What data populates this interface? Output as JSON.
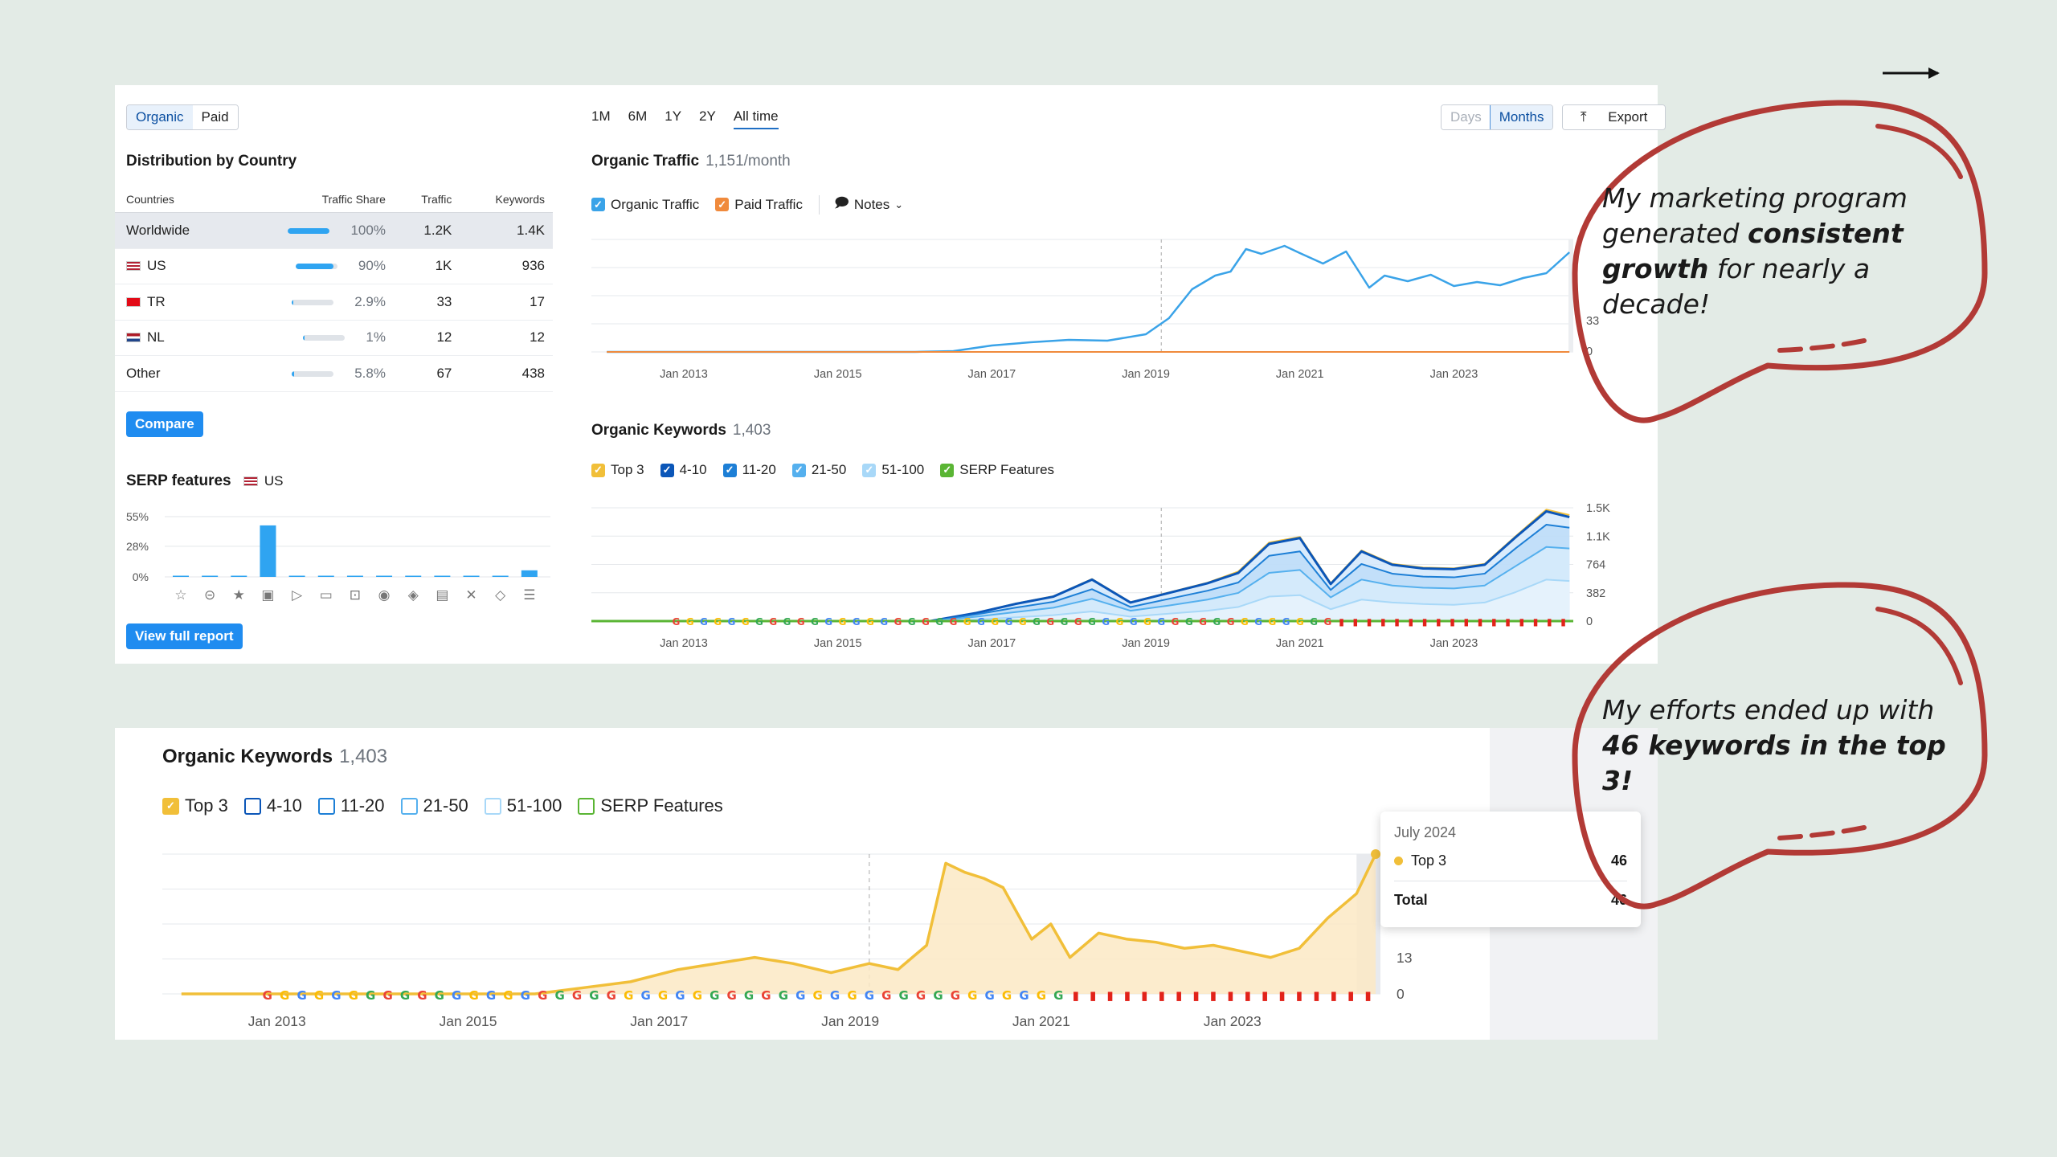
{
  "top_panel": {
    "toggle": {
      "organic": "Organic",
      "paid": "Paid"
    },
    "distribution": {
      "title": "Distribution by Country",
      "headers": [
        "Countries",
        "Traffic Share",
        "Traffic",
        "Keywords"
      ],
      "rows": [
        {
          "country": "Worldwide",
          "share": "100%",
          "share_fraction": 1.0,
          "traffic": "1.2K",
          "keywords": "1.4K"
        },
        {
          "country": "US",
          "share": "90%",
          "share_fraction": 0.9,
          "traffic": "1K",
          "keywords": "936"
        },
        {
          "country": "TR",
          "share": "2.9%",
          "share_fraction": 0.029,
          "traffic": "33",
          "keywords": "17"
        },
        {
          "country": "NL",
          "share": "1%",
          "share_fraction": 0.01,
          "traffic": "12",
          "keywords": "12"
        },
        {
          "country": "Other",
          "share": "5.8%",
          "share_fraction": 0.058,
          "traffic": "67",
          "keywords": "438"
        }
      ]
    },
    "compare_label": "Compare",
    "serp": {
      "title": "SERP features",
      "country": "US",
      "view_full_report": "View full report"
    },
    "time_tabs": [
      "1M",
      "6M",
      "1Y",
      "2Y",
      "All time"
    ],
    "active_tab": "All time",
    "granularity": {
      "days": "Days",
      "months": "Months"
    },
    "export_label": "Export",
    "traffic": {
      "title": "Organic Traffic",
      "value": "1,151/month",
      "legend": [
        "Organic Traffic",
        "Paid Traffic"
      ],
      "notes_label": "Notes"
    },
    "keywords": {
      "title": "Organic Keywords",
      "value": "1,403",
      "legend": [
        "Top 3",
        "4-10",
        "11-20",
        "21-50",
        "51-100",
        "SERP Features"
      ]
    }
  },
  "bottom_panel": {
    "title": "Organic Keywords",
    "value": "1,403",
    "legend": [
      "Top 3",
      "4-10",
      "11-20",
      "21-50",
      "51-100",
      "SERP Features"
    ],
    "tooltip": {
      "date": "July 2024",
      "series": "Top 3",
      "series_value": "46",
      "total_label": "Total",
      "total_value": "46"
    }
  },
  "callouts": {
    "first": {
      "pre": "My marketing program generated ",
      "bold": "consistent growth",
      "post": " for nearly a decade!"
    },
    "second": {
      "pre": "My efforts ended up with ",
      "bold": "46 keywords in the top 3!",
      "post": ""
    }
  },
  "colors": {
    "organic": "#3aa3e8",
    "paid": "#f08a3c",
    "top3": "#f1bf39",
    "k4_10": "#0b56b8",
    "k11_20": "#1d7fd6",
    "k21_50": "#55b0ee",
    "k51_100": "#a8d8f8",
    "serp": "#5ab534",
    "callout": "#b23a36"
  },
  "chart_data": [
    {
      "type": "bar",
      "title": "SERP features",
      "ylabel": "",
      "yticks": [
        "55%",
        "28%",
        "0%"
      ],
      "ylim": [
        0,
        55
      ],
      "categories": [
        "featured snippet",
        "sitelinks",
        "reviews",
        "image",
        "video",
        "featured video",
        "people also ask",
        "local pack",
        "knowledge panel",
        "news",
        "X",
        "shopping",
        "more"
      ],
      "values": [
        0,
        0.5,
        0,
        47,
        0,
        0,
        0.5,
        0,
        0.5,
        0,
        0,
        0.5,
        6
      ]
    },
    {
      "type": "line",
      "title": "Organic Traffic",
      "x_ticks": [
        "Jan 2013",
        "Jan 2015",
        "Jan 2017",
        "Jan 2019",
        "Jan 2021",
        "Jan 2023"
      ],
      "y_ticks": [
        "33",
        "0"
      ],
      "series": [
        {
          "name": "Organic Traffic",
          "x": [
            2012.0,
            2013.0,
            2014.0,
            2015.0,
            2016.0,
            2016.5,
            2017.0,
            2017.5,
            2018.0,
            2018.5,
            2019.0,
            2019.3,
            2019.6,
            2019.9,
            2020.1,
            2020.3,
            2020.5,
            2020.8,
            2021.0,
            2021.3,
            2021.6,
            2021.9,
            2022.1,
            2022.4,
            2022.7,
            2023.0,
            2023.3,
            2023.6,
            2023.9,
            2024.2,
            2024.5
          ],
          "y": [
            0,
            0,
            0,
            0,
            0,
            10,
            80,
            120,
            150,
            140,
            220,
            420,
            780,
            950,
            1000,
            1280,
            1220,
            1320,
            1230,
            1100,
            1250,
            800,
            950,
            880,
            960,
            820,
            870,
            830,
            920,
            980,
            1240
          ]
        },
        {
          "name": "Paid Traffic",
          "x": [
            2012.0,
            2024.5
          ],
          "y": [
            0,
            0
          ]
        }
      ]
    },
    {
      "type": "area",
      "title": "Organic Keywords",
      "x_ticks": [
        "Jan 2013",
        "Jan 2015",
        "Jan 2017",
        "Jan 2019",
        "Jan 2021",
        "Jan 2023"
      ],
      "y_ticks": [
        "1.5K",
        "1.1K",
        "764",
        "382",
        "0"
      ],
      "ylim": [
        0,
        1528
      ],
      "x": [
        2012.0,
        2016.2,
        2016.8,
        2017.3,
        2017.8,
        2018.3,
        2018.8,
        2019.3,
        2019.8,
        2020.2,
        2020.6,
        2021.0,
        2021.4,
        2021.8,
        2022.2,
        2022.6,
        2023.0,
        2023.4,
        2023.8,
        2024.2,
        2024.5
      ],
      "series": [
        {
          "name": "Top 3",
          "values": [
            0,
            0,
            4,
            8,
            10,
            12,
            9,
            11,
            14,
            30,
            32,
            26,
            18,
            22,
            20,
            20,
            18,
            20,
            22,
            40,
            46
          ]
        },
        {
          "name": "4-10",
          "values": [
            0,
            0,
            110,
            230,
            330,
            560,
            250,
            380,
            510,
            650,
            1040,
            1120,
            500,
            940,
            760,
            710,
            700,
            760,
            1130,
            1480,
            1403
          ]
        },
        {
          "name": "11-20",
          "values": [
            0,
            0,
            90,
            180,
            260,
            430,
            190,
            300,
            410,
            520,
            880,
            940,
            420,
            770,
            640,
            600,
            590,
            640,
            980,
            1300,
            1260
          ]
        },
        {
          "name": "21-50",
          "values": [
            0,
            0,
            60,
            120,
            180,
            300,
            140,
            210,
            290,
            380,
            650,
            690,
            320,
            560,
            480,
            450,
            440,
            480,
            740,
            1000,
            980
          ]
        },
        {
          "name": "51-100",
          "values": [
            0,
            0,
            20,
            50,
            80,
            130,
            60,
            100,
            140,
            190,
            330,
            350,
            160,
            290,
            250,
            230,
            220,
            250,
            390,
            560,
            540
          ]
        }
      ]
    },
    {
      "type": "area",
      "title": "Organic Keywords",
      "x_ticks": [
        "Jan 2013",
        "Jan 2015",
        "Jan 2017",
        "Jan 2019",
        "Jan 2021",
        "Jan 2023"
      ],
      "y_ticks": [
        "13",
        "0"
      ],
      "ylim": [
        0,
        46
      ],
      "series": [
        {
          "name": "Top 3",
          "x": [
            2012.0,
            2015.7,
            2016.2,
            2016.7,
            2017.2,
            2017.6,
            2018.0,
            2018.4,
            2018.8,
            2019.2,
            2019.5,
            2019.8,
            2020.0,
            2020.2,
            2020.4,
            2020.6,
            2020.9,
            2021.1,
            2021.3,
            2021.6,
            2021.9,
            2022.2,
            2022.5,
            2022.8,
            2023.1,
            2023.4,
            2023.7,
            2024.0,
            2024.3,
            2024.5
          ],
          "y": [
            0,
            0,
            2,
            4,
            8,
            10,
            12,
            10,
            7,
            10,
            8,
            16,
            43,
            40,
            38,
            35,
            18,
            23,
            12,
            20,
            18,
            17,
            15,
            16,
            14,
            12,
            15,
            25,
            33,
            46
          ]
        }
      ]
    }
  ]
}
